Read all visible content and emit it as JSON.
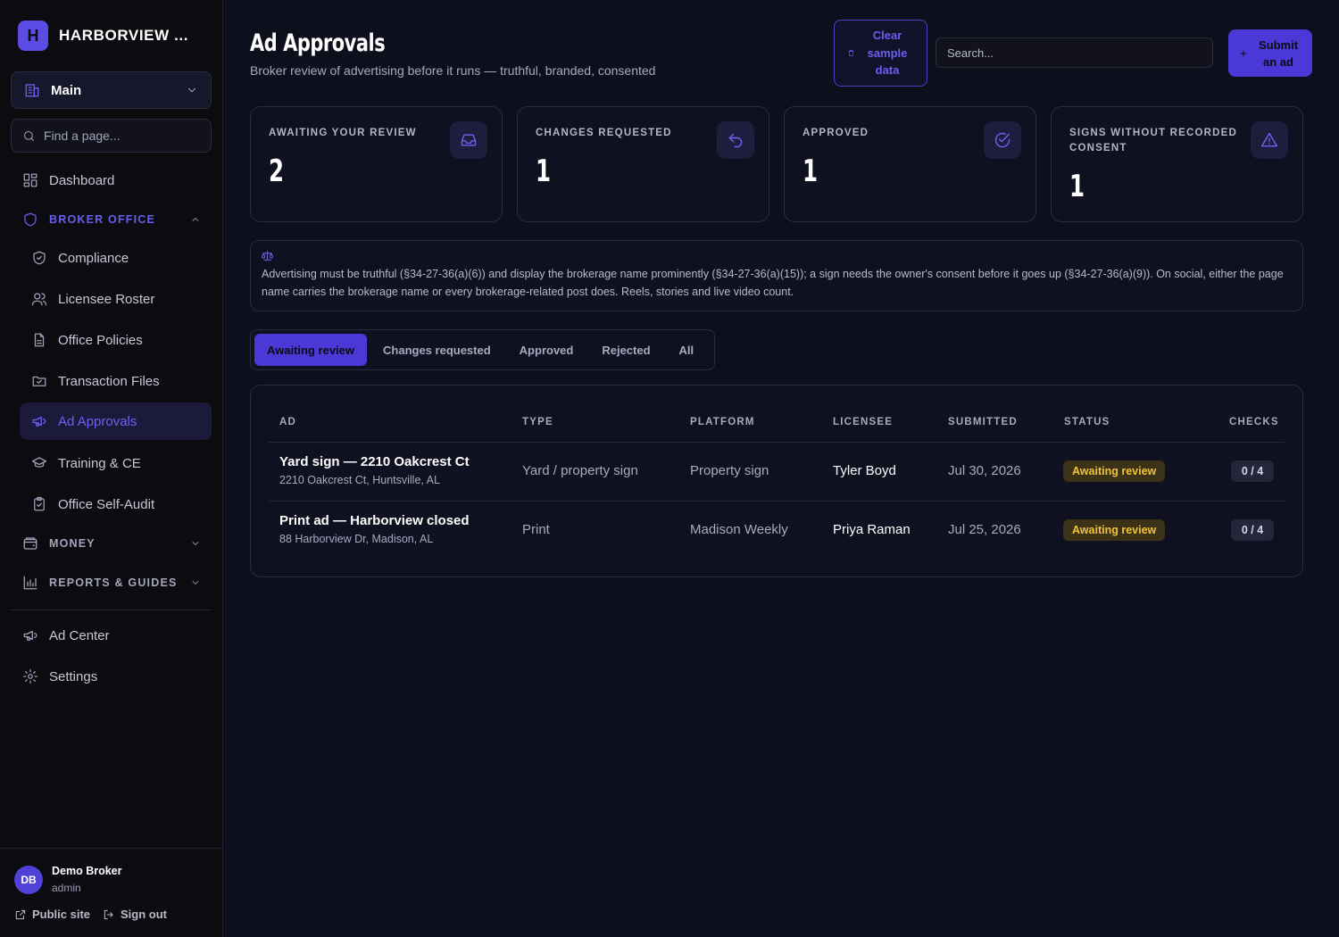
{
  "sidebar": {
    "brand_initial": "H",
    "brand_name": "HARBORVIEW ...",
    "workspace_label": "Main",
    "find_placeholder": "Find a page...",
    "dashboard": "Dashboard",
    "section_broker": "BROKER OFFICE",
    "items": [
      "Compliance",
      "Licensee Roster",
      "Office Policies",
      "Transaction Files",
      "Ad Approvals",
      "Training & CE",
      "Office Self-Audit"
    ],
    "section_money": "MONEY",
    "section_reports": "REPORTS & GUIDES",
    "ad_center": "Ad Center",
    "settings": "Settings",
    "user": {
      "initials": "DB",
      "name": "Demo Broker",
      "role": "admin"
    },
    "public_site": "Public site",
    "sign_out": "Sign out"
  },
  "header": {
    "title": "Ad Approvals",
    "subtitle": "Broker review of advertising before it runs — truthful, branded, consented",
    "clear_label": "Clear sample data",
    "search_placeholder": "Search...",
    "submit_label": "Submit an ad"
  },
  "stats": [
    {
      "label": "AWAITING YOUR REVIEW",
      "value": "2",
      "icon": "inbox-icon"
    },
    {
      "label": "CHANGES REQUESTED",
      "value": "1",
      "icon": "undo-icon"
    },
    {
      "label": "APPROVED",
      "value": "1",
      "icon": "check-circle-icon"
    },
    {
      "label": "SIGNS WITHOUT RECORDED CONSENT",
      "value": "1",
      "icon": "warning-icon"
    }
  ],
  "notice": "Advertising must be truthful (§34-27-36(a)(6)) and display the brokerage name prominently (§34-27-36(a)(15)); a sign needs the owner's consent before it goes up (§34-27-36(a)(9)). On social, either the page name carries the brokerage name or every brokerage-related post does. Reels, stories and live video count.",
  "tabs": [
    "Awaiting review",
    "Changes requested",
    "Approved",
    "Rejected",
    "All"
  ],
  "table": {
    "headers": [
      "AD",
      "TYPE",
      "PLATFORM",
      "LICENSEE",
      "SUBMITTED",
      "STATUS",
      "CHECKS"
    ],
    "rows": [
      {
        "title": "Yard sign — 2210 Oakcrest Ct",
        "address": "2210 Oakcrest Ct, Huntsville, AL",
        "type": "Yard / property sign",
        "platform": "Property sign",
        "licensee": "Tyler Boyd",
        "submitted": "Jul 30, 2026",
        "status": "Awaiting review",
        "checks": "0 / 4"
      },
      {
        "title": "Print ad — Harborview closed",
        "address": "88 Harborview Dr, Madison, AL",
        "type": "Print",
        "platform": "Madison Weekly",
        "licensee": "Priya Raman",
        "submitted": "Jul 25, 2026",
        "status": "Awaiting review",
        "checks": "0 / 4"
      }
    ]
  },
  "colors": {
    "accent": "#5b4ce6",
    "background": "#0e0f1d",
    "sidebar": "#0b0b10",
    "status_awaiting": "#f0c33a"
  }
}
